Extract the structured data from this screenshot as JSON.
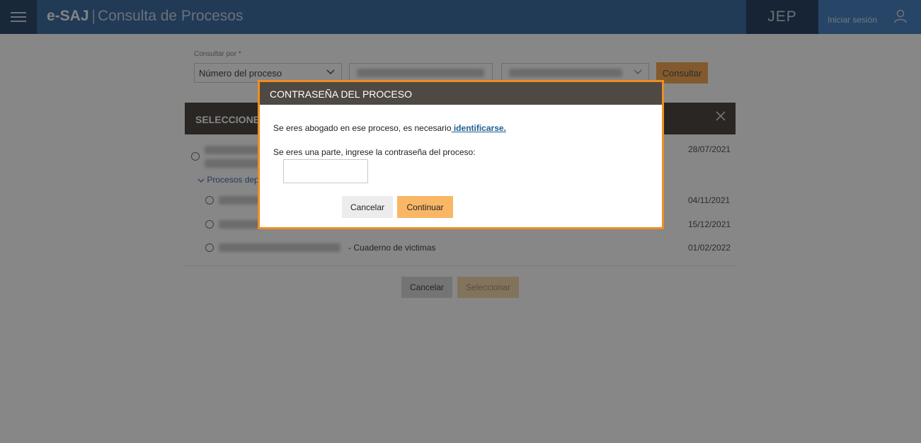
{
  "header": {
    "brand": "e-SAJ",
    "separator": "|",
    "subtitle": "Consulta de Procesos",
    "institution": "JEP",
    "login_label": "Iniciar sesión",
    "menu_icon": "hamburger-icon",
    "user_icon": "user-icon"
  },
  "search": {
    "consult_label": "Consultar por *",
    "consult_type_value": "Número del proceso",
    "consult_button": "Consultar"
  },
  "selection_modal": {
    "title": "SELECCIONE",
    "close_icon": "close-icon",
    "dependent_link": "Procesos dep",
    "rows": [
      {
        "date": "28/07/2021"
      },
      {
        "date": "04/11/2021"
      },
      {
        "date": "15/12/2021"
      },
      {
        "suffix": "- Cuaderno de victimas",
        "date": "01/02/2022"
      }
    ],
    "cancel_button": "Cancelar",
    "select_button": "Seleccionar"
  },
  "password_dialog": {
    "title": "CONTRASEÑA DEL PROCESO",
    "lawyer_text": "Se eres abogado en ese proceso, es necesario",
    "identify_link": " identificarse.",
    "party_text": "Se eres una parte, ingrese la contraseña del proceso:",
    "password_value": "",
    "cancel_button": "Cancelar",
    "continue_button": "Continuar"
  },
  "colors": {
    "header_bg": "#3f6fa2",
    "dialog_border": "#ef8e22",
    "dialog_header": "#4f4943",
    "accent_button": "#f9b766"
  }
}
